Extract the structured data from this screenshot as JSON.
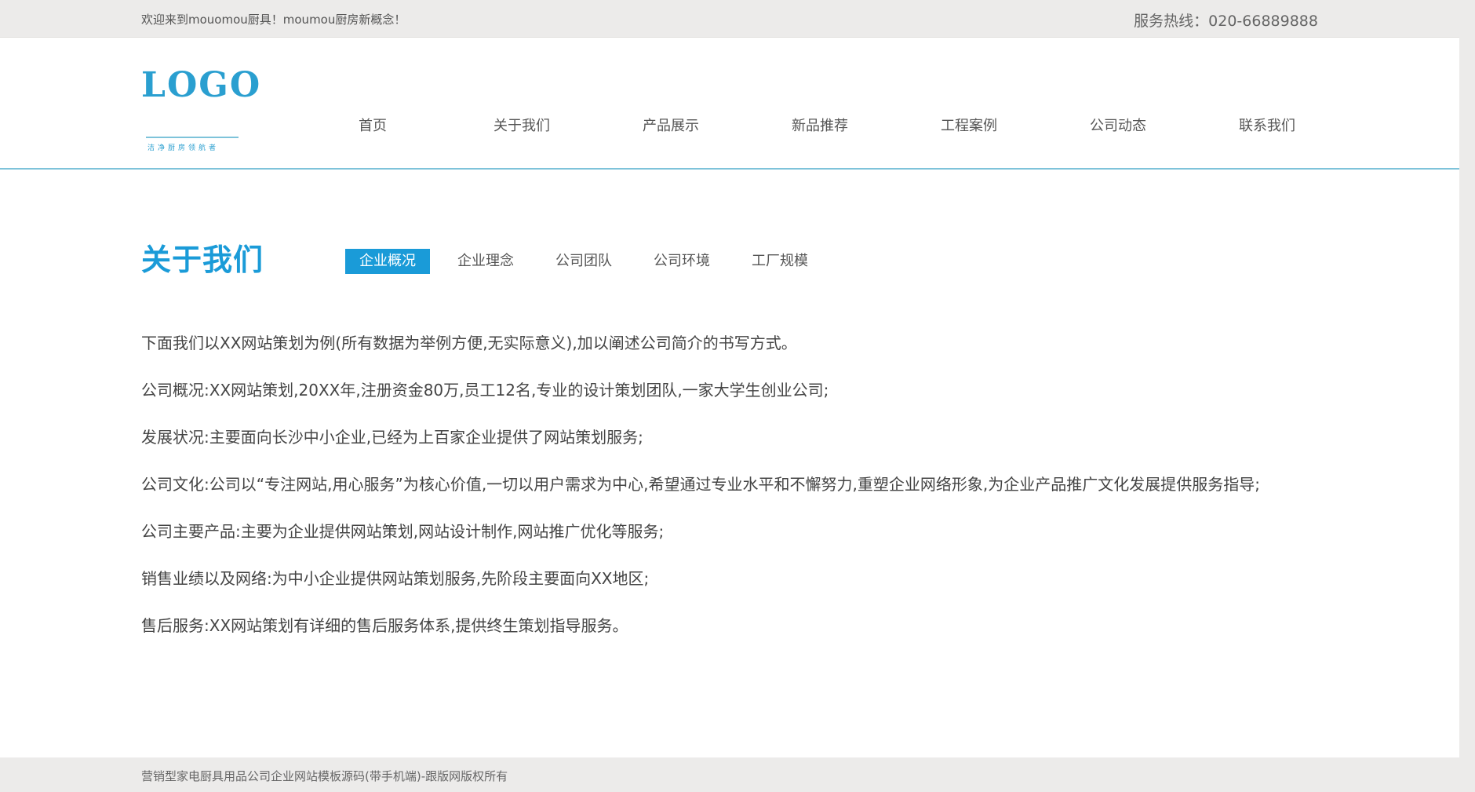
{
  "topbar": {
    "welcome": "欢迎来到mouomou厨具！moumou厨房新概念！",
    "hotline": "服务热线：020-66889888"
  },
  "header": {
    "logo_text": "LOGO",
    "logo_sub": "洁净厨房领航者",
    "nav": [
      {
        "label": "首页"
      },
      {
        "label": "关于我们"
      },
      {
        "label": "产品展示"
      },
      {
        "label": "新品推荐"
      },
      {
        "label": "工程案例"
      },
      {
        "label": "公司动态"
      },
      {
        "label": "联系我们"
      }
    ]
  },
  "section": {
    "title": "关于我们",
    "tabs": [
      {
        "label": "企业概况",
        "active": true
      },
      {
        "label": "企业理念",
        "active": false
      },
      {
        "label": "公司团队",
        "active": false
      },
      {
        "label": "公司环境",
        "active": false
      },
      {
        "label": "工厂规模",
        "active": false
      }
    ]
  },
  "content": {
    "paragraphs": [
      " 下面我们以XX网站策划为例(所有数据为举例方便,无实际意义),加以阐述公司简介的书写方式。",
      "公司概况:XX网站策划,20XX年,注册资金80万,员工12名,专业的设计策划团队,一家大学生创业公司;",
      "发展状况:主要面向长沙中小企业,已经为上百家企业提供了网站策划服务;",
      "公司文化:公司以“专注网站,用心服务”为核心价值,一切以用户需求为中心,希望通过专业水平和不懈努力,重塑企业网络形象,为企业产品推广文化发展提供服务指导;",
      "公司主要产品:主要为企业提供网站策划,网站设计制作,网站推广优化等服务;",
      "销售业绩以及网络:为中小企业提供网站策划服务,先阶段主要面向XX地区;",
      "售后服务:XX网站策划有详细的售后服务体系,提供终生策划指导服务。"
    ]
  },
  "footer": {
    "copyright": "营销型家电厨具用品公司企业网站模板源码(带手机端)-跟版网版权所有"
  },
  "colors": {
    "accent": "#1a9bd8",
    "topbar_bg": "#ecebea",
    "header_border": "#7ec3da"
  }
}
